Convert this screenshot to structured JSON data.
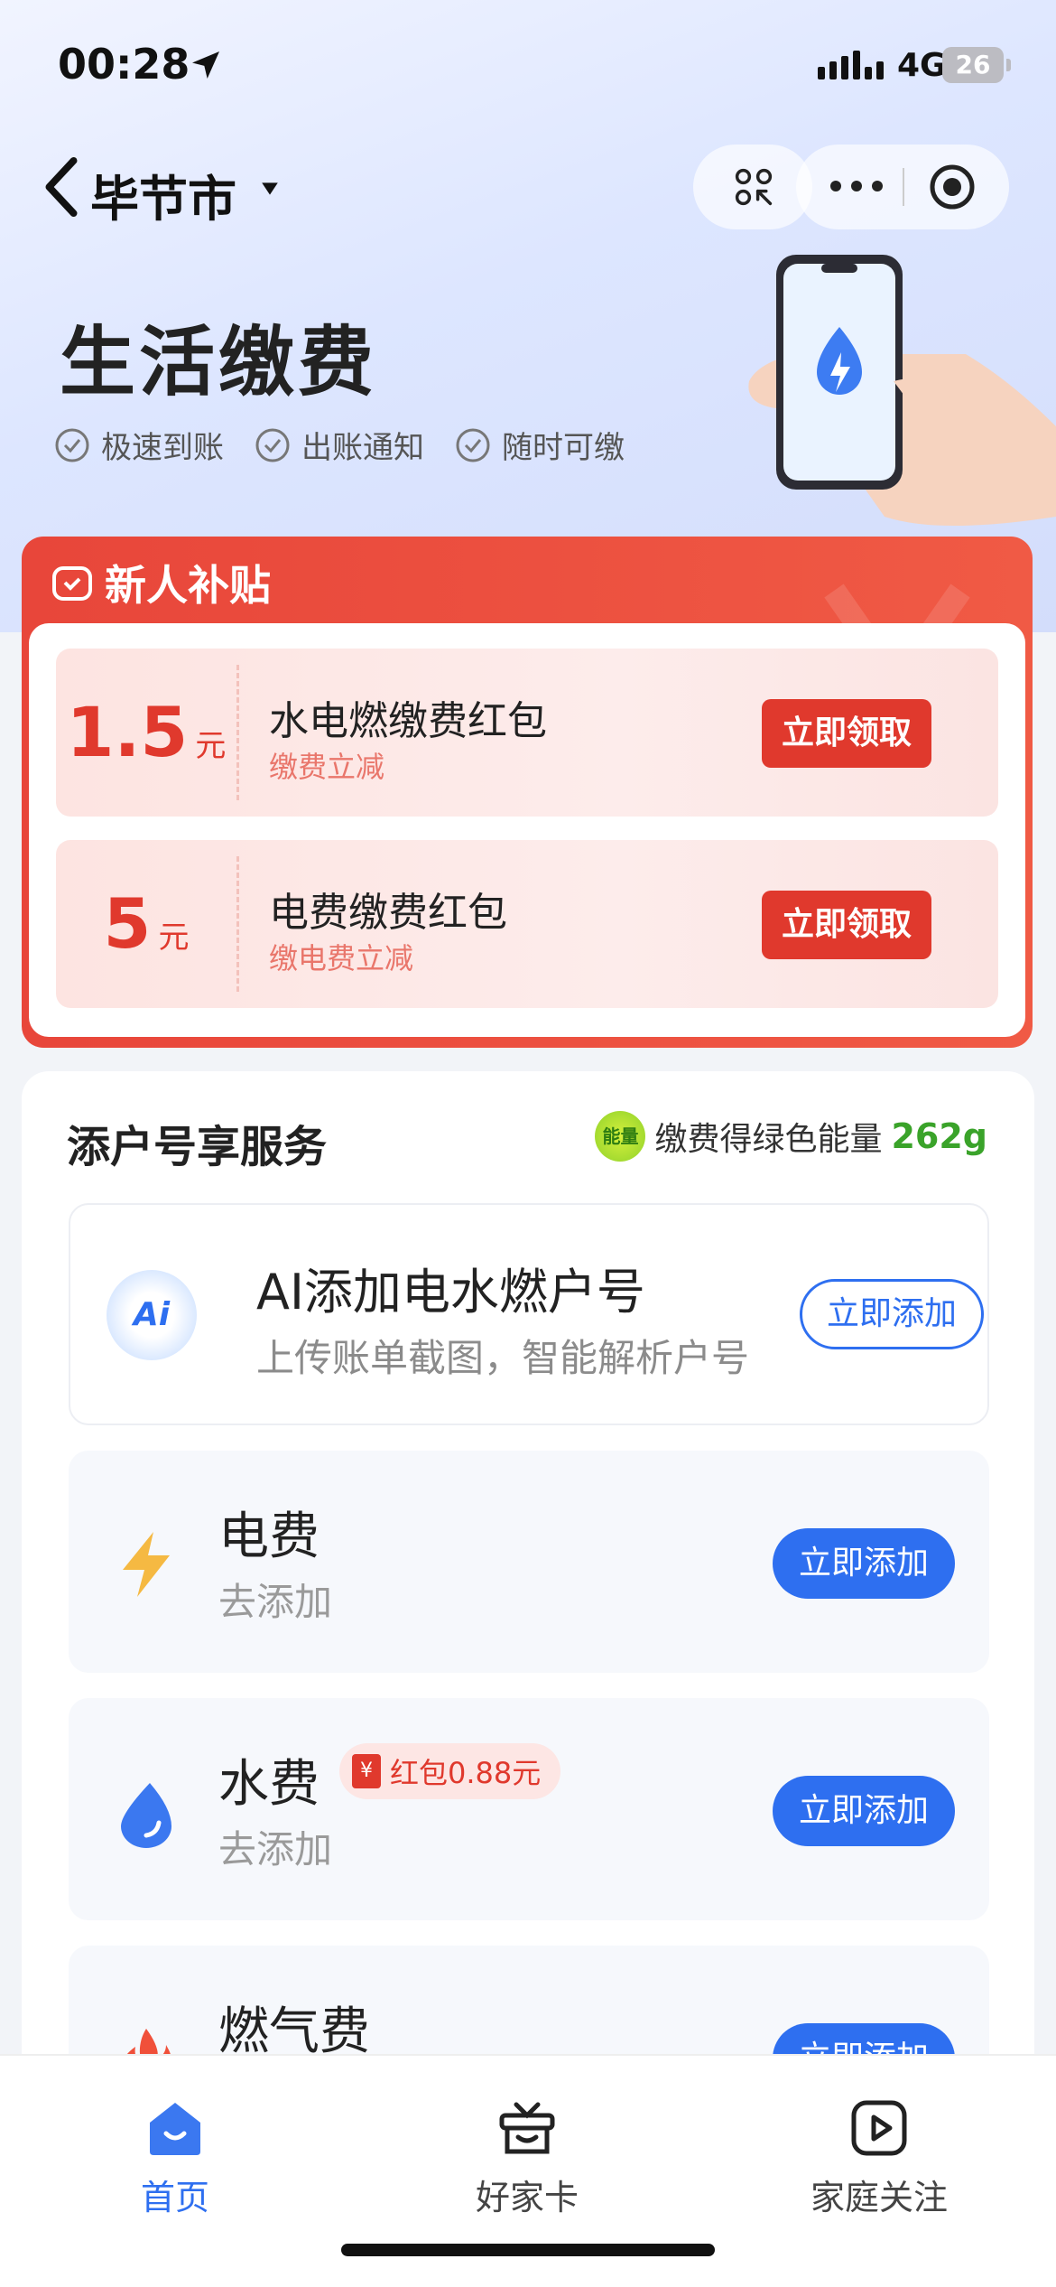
{
  "status_bar": {
    "time": "00:28",
    "network": "4G",
    "battery": "26"
  },
  "nav": {
    "city": "毕节市"
  },
  "hero": {
    "title": "生活缴费",
    "features": [
      "极速到账",
      "出账通知",
      "随时可缴"
    ]
  },
  "subsidy": {
    "title": "新人补贴",
    "coupons": [
      {
        "amount": "1.5",
        "unit": "元",
        "title": "水电燃缴费红包",
        "subtitle": "缴费立减",
        "button": "立即领取"
      },
      {
        "amount": "5",
        "unit": "元",
        "title": "电费缴费红包",
        "subtitle": "缴电费立减",
        "button": "立即领取"
      }
    ]
  },
  "services": {
    "title": "添户号享服务",
    "energy_badge": "能量",
    "energy_text": "缴费得绿色能量",
    "energy_value": "262g",
    "ai_card": {
      "icon_text": "Ai",
      "title": "AI添加电水燃户号",
      "subtitle": "上传账单截图，智能解析户号",
      "button": "立即添加"
    },
    "items": [
      {
        "title": "电费",
        "subtitle": "去添加",
        "button": "立即添加"
      },
      {
        "title": "水费",
        "subtitle": "去添加",
        "button": "立即添加",
        "badge_icon": "¥",
        "badge": "红包0.88元"
      },
      {
        "title": "燃气费",
        "subtitle": "",
        "button": "立即添加"
      }
    ]
  },
  "tabbar": {
    "tabs": [
      {
        "label": "首页",
        "active": true
      },
      {
        "label": "好家卡",
        "active": false
      },
      {
        "label": "家庭关注",
        "active": false
      }
    ]
  },
  "colors": {
    "accent_blue": "#2e6ff0",
    "accent_red": "#e0392d",
    "energy_green": "#3aa32a"
  }
}
